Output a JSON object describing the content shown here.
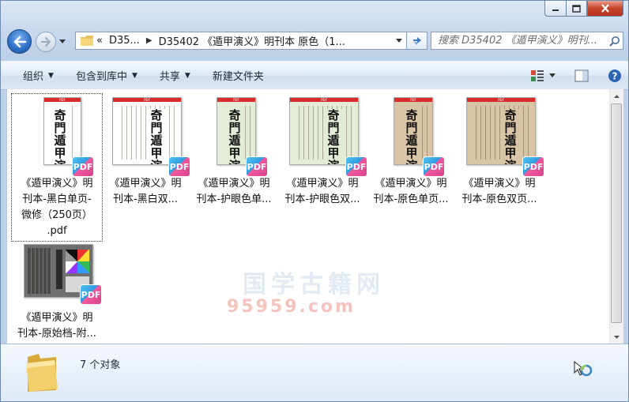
{
  "window": {
    "caption": {
      "minimize": "minimize",
      "maximize": "maximize",
      "close": "close"
    }
  },
  "nav": {
    "crumb_prefix": "«",
    "crumb_1": "D35...",
    "crumb_2": "D35402 《遁甲演义》明刊本 原色（1...",
    "search_placeholder": "搜索 D35402 《遁甲演义》明刊..."
  },
  "toolbar": {
    "organize": "组织",
    "include_library": "包含到库中",
    "share": "共享",
    "new_folder": "新建文件夹"
  },
  "files": [
    {
      "line1": "《遁甲演义》明",
      "line2": "刊本-黑白单页-",
      "line3": "微修（250页）",
      "line4": ".pdf"
    },
    {
      "line1": "《遁甲演义》明",
      "line2": "刊本-黑白双..."
    },
    {
      "line1": "《遁甲演义》明",
      "line2": "刊本-护眼色单..."
    },
    {
      "line1": "《遁甲演义》明",
      "line2": "刊本-护眼色双..."
    },
    {
      "line1": "《遁甲演义》明",
      "line2": "刊本-原色单页..."
    },
    {
      "line1": "《遁甲演义》明",
      "line2": "刊本-原色双页..."
    },
    {
      "line1": "《遁甲演义》明",
      "line2": "刊本-原始档-附..."
    }
  ],
  "thumb": {
    "pdf_badge": "PDF",
    "cover_title": "奇門遁甲演義"
  },
  "status": {
    "count": "7 个对象"
  },
  "watermark": {
    "site": "95959.com"
  },
  "colors": {
    "bw": "#ffffff",
    "eye": "#e3ecd6",
    "orig": "#d9c4a6"
  }
}
